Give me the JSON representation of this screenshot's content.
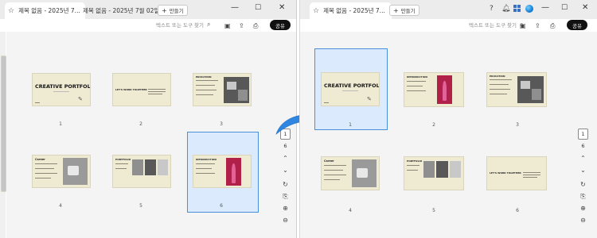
{
  "left_window": {
    "tabs": [
      {
        "label": "제목 없음 - 2025년 7...",
        "active": true
      },
      {
        "label": "제목 없음 - 2025년 7월 02일...",
        "active": false
      }
    ],
    "new_tab_label": "만들기",
    "search_placeholder": "텍스트 또는 도구 찾기",
    "share_label": "공유",
    "current_page": "1",
    "total_pages": "6",
    "selected_page": "6",
    "pages": [
      {
        "number": "1",
        "title": "CREATIVE PORTFOLIO",
        "kind": "cover"
      },
      {
        "number": "2",
        "title": "LET'S WORK TOGETHER",
        "kind": "contact"
      },
      {
        "number": "3",
        "title": "EDUCATION",
        "kind": "education"
      },
      {
        "number": "4",
        "title": "Career",
        "kind": "career"
      },
      {
        "number": "5",
        "title": "PORTFOLIO",
        "kind": "portfolio"
      },
      {
        "number": "6",
        "title": "INTRODUCTION",
        "kind": "intro"
      }
    ]
  },
  "right_window": {
    "tabs": [
      {
        "label": "제목 없음 - 2025년 7...",
        "active": true
      }
    ],
    "new_tab_label": "만들기",
    "search_placeholder": "텍스트 또는 도구 찾기",
    "share_label": "공유",
    "current_page": "1",
    "total_pages": "6",
    "selected_page": "1",
    "pages": [
      {
        "number": "1",
        "title": "CREATIVE PORTFOLIO",
        "kind": "cover"
      },
      {
        "number": "2",
        "title": "INTRODUCTION",
        "kind": "intro"
      },
      {
        "number": "3",
        "title": "EDUCATION",
        "kind": "education"
      },
      {
        "number": "4",
        "title": "Career",
        "kind": "career"
      },
      {
        "number": "5",
        "title": "PORTFOLIO",
        "kind": "portfolio"
      },
      {
        "number": "6",
        "title": "LET'S WORK TOGETHER",
        "kind": "contact"
      }
    ]
  },
  "icons": {
    "star": "star-icon",
    "search": "search-icon",
    "save": "save-icon",
    "upload": "upload-icon",
    "print": "print-icon",
    "chevron_up": "chevron-up-icon",
    "chevron_down": "chevron-down-icon",
    "refresh": "refresh-icon",
    "zoom_in": "zoom-in-icon",
    "zoom_out": "zoom-out-icon"
  },
  "colors": {
    "selection_fill": "#dbeafc",
    "selection_border": "#4a90d9",
    "arrow": "#2f86e0",
    "share_button": "#111111",
    "slide_background": "#efebd3"
  }
}
